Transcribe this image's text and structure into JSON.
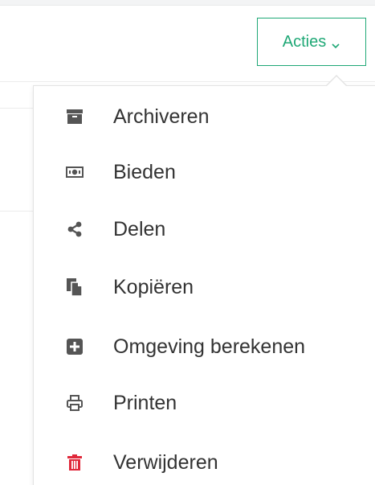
{
  "actions_button": {
    "label": "Acties",
    "accent_color": "#1fa876"
  },
  "menu": {
    "items": [
      {
        "label": "Archiveren",
        "icon": "archive-icon",
        "color": "#555555"
      },
      {
        "label": "Bieden",
        "icon": "money-icon",
        "color": "#555555"
      },
      {
        "label": "Delen",
        "icon": "share-icon",
        "color": "#555555"
      },
      {
        "label": "Kopiëren",
        "icon": "copy-icon",
        "color": "#555555"
      },
      {
        "label": "Omgeving berekenen",
        "icon": "plus-square-icon",
        "color": "#555555"
      },
      {
        "label": "Printen",
        "icon": "print-icon",
        "color": "#555555"
      },
      {
        "label": "Verwijderen",
        "icon": "trash-icon",
        "color": "#e0283a"
      }
    ]
  }
}
